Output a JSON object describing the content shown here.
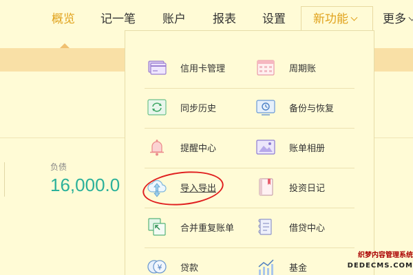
{
  "nav": {
    "items": [
      {
        "label": "概览"
      },
      {
        "label": "记一笔"
      },
      {
        "label": "账户"
      },
      {
        "label": "报表"
      },
      {
        "label": "设置"
      },
      {
        "label": "新功能"
      },
      {
        "label": "更多"
      }
    ]
  },
  "summary": {
    "debt_label": "负债",
    "debt_value": "16,000.0"
  },
  "menu": {
    "items": [
      {
        "label": "信用卡管理",
        "icon": "credit-card-icon"
      },
      {
        "label": "周期账",
        "icon": "calendar-icon"
      },
      {
        "label": "同步历史",
        "icon": "sync-icon"
      },
      {
        "label": "备份与恢复",
        "icon": "backup-restore-icon"
      },
      {
        "label": "提醒中心",
        "icon": "bell-icon"
      },
      {
        "label": "账单相册",
        "icon": "photo-album-icon"
      },
      {
        "label": "导入导出",
        "icon": "import-export-icon"
      },
      {
        "label": "投资日记",
        "icon": "diary-icon"
      },
      {
        "label": "合并重复账单",
        "icon": "merge-icon"
      },
      {
        "label": "借贷中心",
        "icon": "loan-icon"
      },
      {
        "label": "贷款",
        "icon": "yen-coins-icon"
      },
      {
        "label": "基金",
        "icon": "fund-chart-icon"
      }
    ]
  },
  "colors": {
    "background": "#fffbd6",
    "accent": "#e0a21c",
    "band": "#f9e0a6",
    "debt_value": "#2bb19a",
    "highlight_ellipse": "#e02020"
  },
  "watermark": {
    "line1": "织梦内容管理系统",
    "line2": "DEDECMS.COM"
  }
}
